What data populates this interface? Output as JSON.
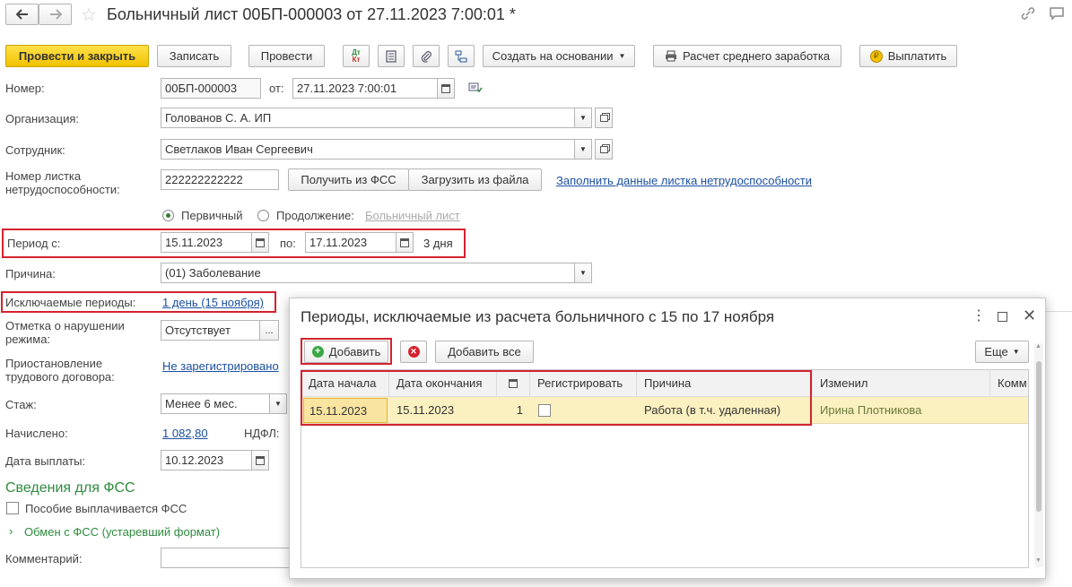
{
  "window": {
    "title": "Больничный лист 00БП-000003 от 27.11.2023 7:00:01 *"
  },
  "toolbar": {
    "post_close": "Провести и закрыть",
    "save": "Записать",
    "post": "Провести",
    "dtkt_top": "Дт",
    "dtkt_bottom": "Кт",
    "create_based": "Создать на основании",
    "avg_calc": "Расчет среднего заработка",
    "pay": "Выплатить"
  },
  "form": {
    "number_label": "Номер:",
    "number_value": "00БП-000003",
    "date_from_label": "от:",
    "date_value": "27.11.2023  7:00:01",
    "org_label": "Организация:",
    "org_value": "Голованов С. А. ИП",
    "employee_label": "Сотрудник:",
    "employee_value": "Светлаков Иван Сергеевич",
    "sheet_label_1": "Номер листка",
    "sheet_label_2": "нетрудоспособности:",
    "sheet_value": "222222222222",
    "get_fss": "Получить из ФСС",
    "load_file": "Загрузить из файла",
    "fill_link": "Заполнить данные листка нетрудоспособности",
    "primary_label": "Первичный",
    "continuation_label": "Продолжение:",
    "continuation_link": "Больничный лист",
    "period_label": "Период с:",
    "period_from": "15.11.2023",
    "period_to_label": "по:",
    "period_to": "17.11.2023",
    "period_days": "3 дня",
    "reason_label": "Причина:",
    "reason_value": "(01) Заболевание",
    "excluded_label": "Исключаемые периоды:",
    "excluded_link": "1 день (15 ноября)",
    "violation_label_1": "Отметка о нарушении",
    "violation_label_2": "режима:",
    "violation_value": "Отсутствует",
    "suspension_label_1": "Приостановление",
    "suspension_label_2": "трудового договора:",
    "suspension_link": "Не зарегистрировано",
    "tenure_label": "Стаж:",
    "tenure_value": "Менее 6 мес.",
    "accrued_label": "Начислено:",
    "accrued_value": "1 082,80",
    "ndfl_label": "НДФЛ:",
    "pay_date_label": "Дата выплаты:",
    "pay_date_value": "10.12.2023",
    "fss_heading": "Сведения для ФСС",
    "fss_benefit_label": "Пособие выплачивается ФСС",
    "fss_exchange": "Обмен с ФСС (устаревший формат)",
    "comment_label": "Комментарий:"
  },
  "modal": {
    "title": "Периоды, исключаемые из расчета больничного с 15 по 17 ноября",
    "add": "Добавить",
    "add_all": "Добавить все",
    "more": "Еще",
    "columns": [
      "Дата начала",
      "Дата окончания",
      "",
      "Регистрировать",
      "Причина",
      "Изменил",
      "Комм"
    ],
    "row": {
      "start": "15.11.2023",
      "end": "15.11.2023",
      "count": "1",
      "reason": "Работа (в т.ч. удаленная)",
      "changed_by": "Ирина Плотникова"
    }
  },
  "colors": {
    "accent_yellow": "#f5c800",
    "highlight_red": "#d3232f",
    "link_blue": "#1b4fa0",
    "heading_green": "#2e8b3e",
    "row_selected": "#fbf0c0"
  }
}
